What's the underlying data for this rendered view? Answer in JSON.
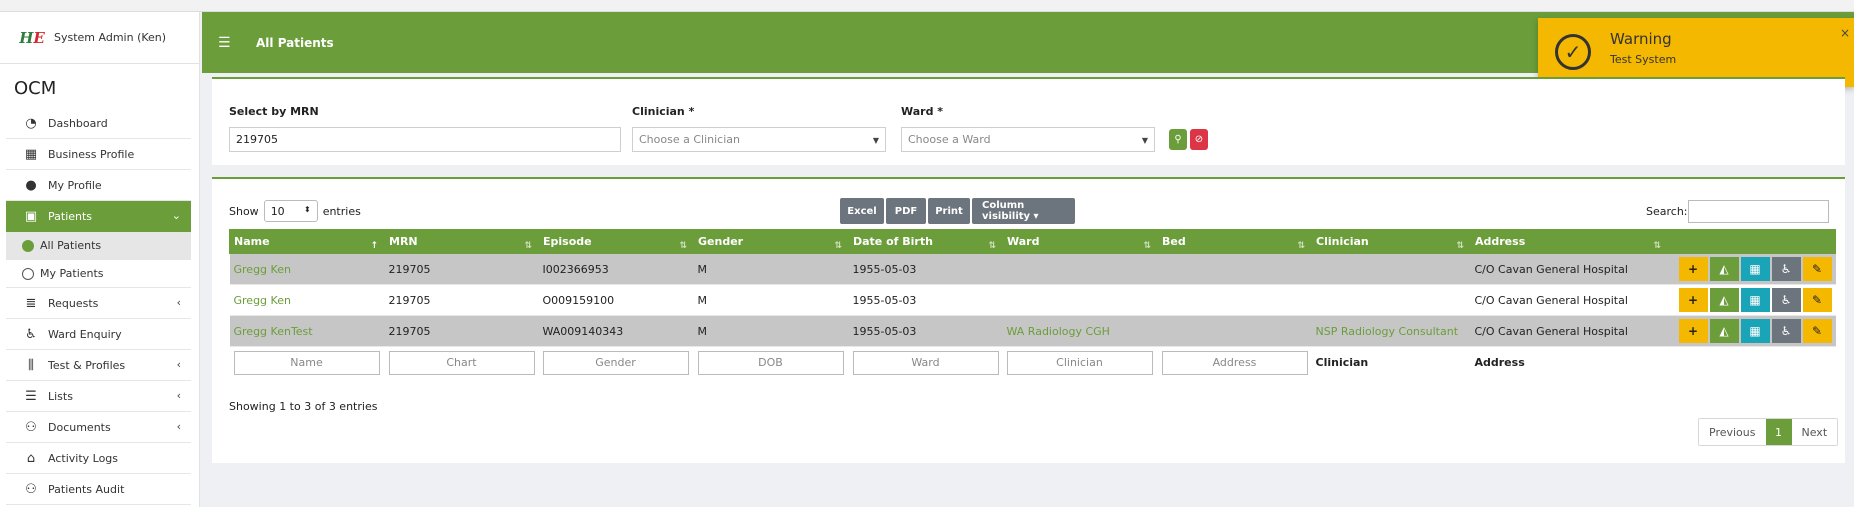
{
  "user": {
    "name": "System Admin (Ken)",
    "logo_text": "H",
    "logo_accent": "E"
  },
  "brand": "OCM",
  "nav": {
    "dashboard": "Dashboard",
    "business_profile": "Business Profile",
    "my_profile": "My Profile",
    "patients": "Patients",
    "all_patients": "All Patients",
    "my_patients": "My Patients",
    "requests": "Requests",
    "ward_enquiry": "Ward Enquiry",
    "test_profiles": "Test & Profiles",
    "lists": "Lists",
    "documents": "Documents",
    "activity_logs": "Activity Logs",
    "patients_audit": "Patients Audit"
  },
  "header": {
    "title": "All Patients"
  },
  "toast": {
    "title": "Warning",
    "message": "Test System",
    "close": "×"
  },
  "filters": {
    "mrn_label": "Select by MRN",
    "mrn_value": "219705",
    "clinician_label": "Clinician *",
    "clinician_placeholder": "Choose a Clinician",
    "ward_label": "Ward *",
    "ward_placeholder": "Choose a Ward"
  },
  "table_controls": {
    "show": "Show",
    "entries_value": "10",
    "entries": "entries",
    "buttons": {
      "excel": "Excel",
      "pdf": "PDF",
      "print": "Print",
      "colvis": "Column visibility ▾"
    },
    "search_label": "Search:"
  },
  "columns": {
    "name": "Name",
    "mrn": "MRN",
    "episode": "Episode",
    "gender": "Gender",
    "dob": "Date of Birth",
    "ward": "Ward",
    "bed": "Bed",
    "clinician": "Clinician",
    "address": "Address"
  },
  "rows": [
    {
      "name": "Gregg Ken",
      "mrn": "219705",
      "episode": "I002366953",
      "gender": "M",
      "dob": "1955-05-03",
      "ward": "",
      "bed": "",
      "clinician": "",
      "address": "C/O Cavan General Hospital"
    },
    {
      "name": "Gregg Ken",
      "mrn": "219705",
      "episode": "O009159100",
      "gender": "M",
      "dob": "1955-05-03",
      "ward": "",
      "bed": "",
      "clinician": "",
      "address": "C/O Cavan General Hospital"
    },
    {
      "name": "Gregg KenTest",
      "mrn": "219705",
      "episode": "WA009140343",
      "gender": "M",
      "dob": "1955-05-03",
      "ward": "WA Radiology CGH",
      "bed": "",
      "clinician": "NSP Radiology Consultant",
      "address": "C/O Cavan General Hospital"
    }
  ],
  "footer_filters": {
    "name": "Name",
    "chart": "Chart",
    "gender": "Gender",
    "dob": "DOB",
    "ward": "Ward",
    "clinician": "Clinician",
    "address": "Address",
    "clinician_text": "Clinician",
    "address_text": "Address"
  },
  "info": "Showing 1 to 3 of 3 entries",
  "pager": {
    "previous": "Previous",
    "current": "1",
    "next": "Next"
  },
  "colors": {
    "accent": "#6b9e3b",
    "warning": "#f5b800",
    "teal": "#1aa4b8",
    "gray": "#6c757d",
    "danger": "#dc3545"
  }
}
